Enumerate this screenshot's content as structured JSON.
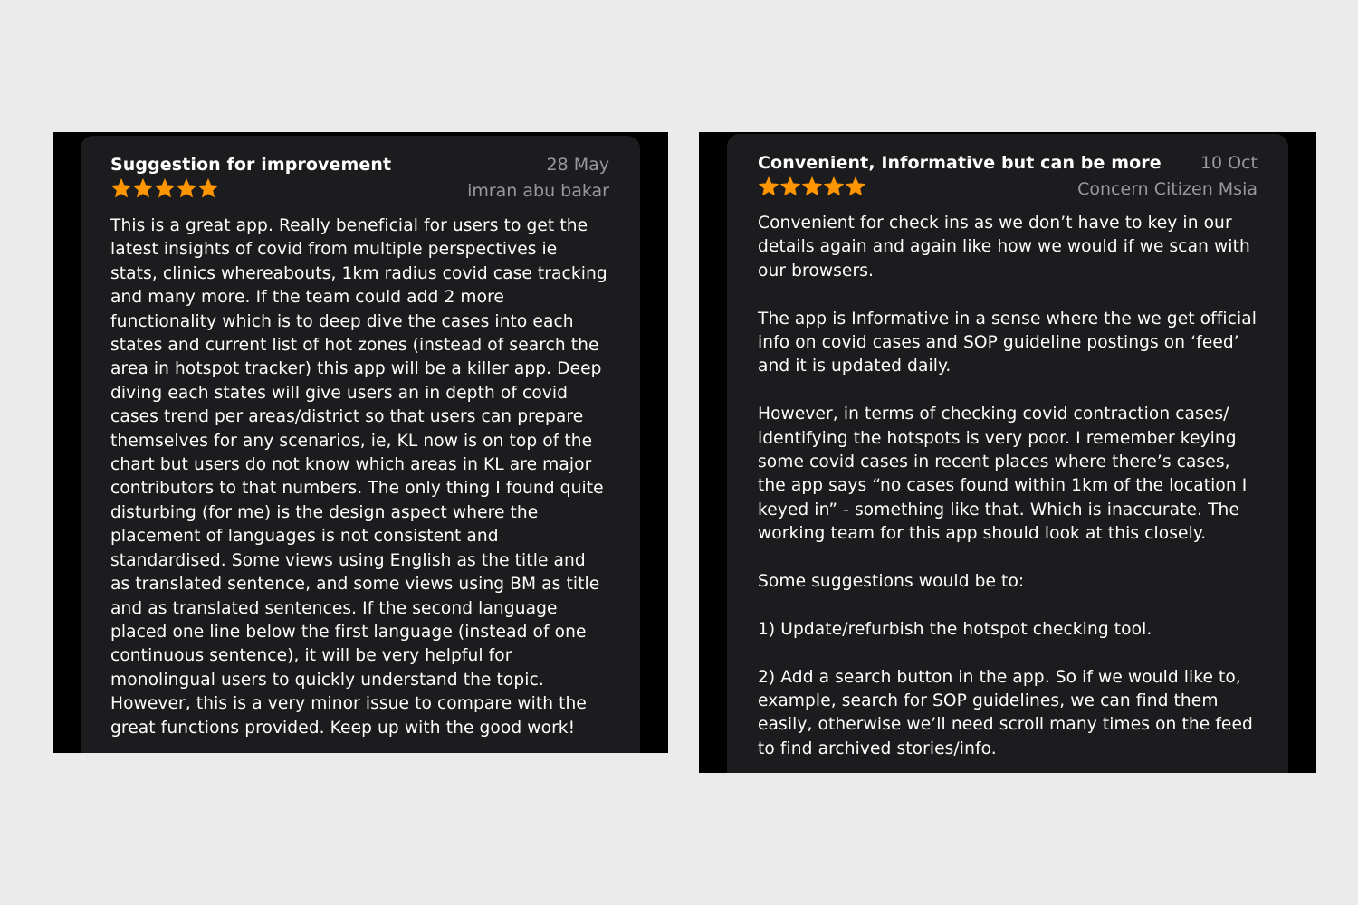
{
  "colors": {
    "page_background": "#ebebeb",
    "frame_background": "#000000",
    "card_background": "#1c1c1e",
    "title_text": "#ffffff",
    "secondary_text": "#98989d",
    "star_color": "#ff9500"
  },
  "reviews": [
    {
      "title": "Suggestion for improvement",
      "date": "28 May",
      "author": "imran abu bakar",
      "rating": 5,
      "rating_max": 5,
      "star_icon": "star-icon",
      "paragraphs": [
        "This is a great app. Really beneficial for users to get the latest insights of covid from multiple perspectives ie stats, clinics whereabouts, 1km radius covid case tracking and many more. If the team could add 2 more functionality which is to deep dive the cases into each states and current list of hot zones (instead of search the area in hotspot tracker) this app will be a killer app. Deep diving each states will give users an in depth of covid cases trend per areas/district so that users can prepare themselves for any scenarios, ie, KL now is on top of the chart but users do not know which areas in KL are major contributors to that numbers. The only thing I found quite disturbing (for me) is the design aspect where the placement of languages is not consistent and standardised. Some views using English as the title and as translated sentence, and some views using BM as title and as translated sentences. If the second language placed one line below the first language (instead of one continuous sentence), it will be very helpful for monolingual users to quickly understand the topic. However, this is a very minor issue to compare with the great functions provided. Keep up with the good work!"
      ]
    },
    {
      "title": "Convenient, Informative but can be more",
      "date": "10 Oct",
      "author": "Concern Citizen Msia",
      "rating": 5,
      "rating_max": 5,
      "star_icon": "star-icon",
      "paragraphs": [
        "Convenient for check ins as we don’t have to key in our details again and again like how we would if we scan with our browsers.",
        "The app is Informative in a sense where the we get official info on covid cases and SOP guideline postings on ‘feed’ and it is updated daily.",
        "However, in terms of checking covid contraction cases/ identifying the hotspots is very poor. I remember keying some covid cases in recent places where there’s cases, the app says “no cases found within 1km of the location I keyed in” - something like that. Which is inaccurate. The working team for this app should look at this closely.",
        "Some suggestions would be to:",
        "1) Update/refurbish the hotspot checking tool.",
        "2) Add a search button in the app. So if we would like to, example, search for SOP guidelines, we can find them easily, otherwise we’ll need scroll many times on the feed to find archived stories/info."
      ]
    }
  ]
}
